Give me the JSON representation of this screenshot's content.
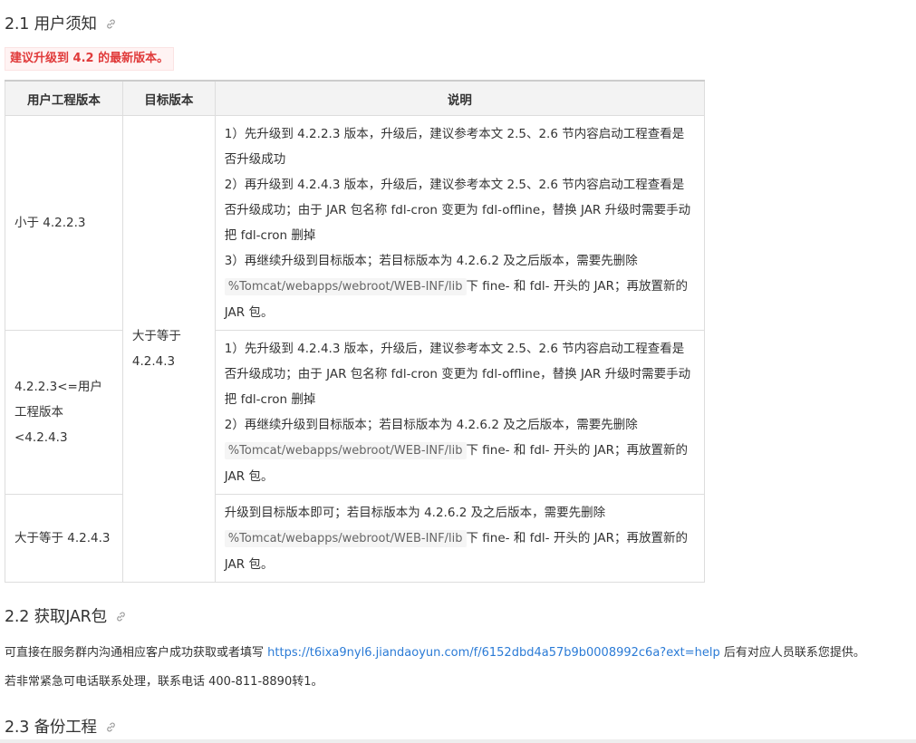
{
  "section_2_1": {
    "title": "2.1 用户须知",
    "notice": "建议升级到 4.2 的最新版本。"
  },
  "table": {
    "headers": [
      "用户工程版本",
      "目标版本",
      "说明"
    ],
    "target_version": "大于等于 4.2.4.3",
    "rows": [
      {
        "user_version": "小于 4.2.2.3",
        "desc": {
          "step1": "1）先升级到 4.2.2.3 版本，升级后，建议参考本文 2.5、2.6 节内容启动工程查看是否升级成功",
          "step2": "2）再升级到 4.2.4.3 版本，升级后，建议参考本文 2.5、2.6 节内容启动工程查看是否升级成功；由于 JAR 包名称 fdl-cron 变更为 fdl-offline，替换 JAR 升级时需要手动把 fdl-cron 删掉",
          "step3_pre": "3）再继续升级到目标版本；若目标版本为 4.2.6.2 及之后版本，需要先删除",
          "path": "%Tomcat/webapps/webroot/WEB-INF/lib",
          "step3_post": "下 fine- 和 fdl- 开头的 JAR；再放置新的 JAR 包。"
        }
      },
      {
        "user_version": "4.2.2.3<=用户工程版本<4.2.4.3",
        "desc": {
          "step1": "1）先升级到 4.2.4.3 版本，升级后，建议参考本文 2.5、2.6 节内容启动工程查看是否升级成功；由于 JAR 包名称 fdl-cron 变更为 fdl-offline，替换 JAR 升级时需要手动把 fdl-cron 删掉",
          "step2_pre": "2）再继续升级到目标版本；若目标版本为 4.2.6.2 及之后版本，需要先删除",
          "path": "%Tomcat/webapps/webroot/WEB-INF/lib",
          "step2_post": "下 fine- 和 fdl- 开头的 JAR；再放置新的 JAR 包。"
        }
      },
      {
        "user_version": "大于等于 4.2.4.3",
        "desc": {
          "pre": "升级到目标版本即可；若目标版本为 4.2.6.2 及之后版本，需要先删除",
          "path": "%Tomcat/webapps/webroot/WEB-INF/lib",
          "post": "下 fine- 和 fdl- 开头的 JAR；再放置新的 JAR 包。"
        }
      }
    ]
  },
  "section_2_2": {
    "title": "2.2 获取JAR包",
    "p1_pre": "可直接在服务群内沟通相应客户成功获取或者填写",
    "p1_link": "https://t6ixa9nyl6.jiandaoyun.com/f/6152dbd4a57b9b0008992c6a?ext=help",
    "p1_post": "后有对应人员联系您提供。",
    "p2": "若非常紧急可电话联系处理，联系电话 400-811-8890转1。"
  },
  "section_2_3": {
    "title": "2.3 备份工程"
  },
  "icons": {
    "anchor": "link-icon"
  },
  "colors": {
    "notice_text": "#e03a3a",
    "notice_bg": "#fff3f3",
    "link": "#2b7bd6",
    "header_bg": "#f3f3f3"
  }
}
